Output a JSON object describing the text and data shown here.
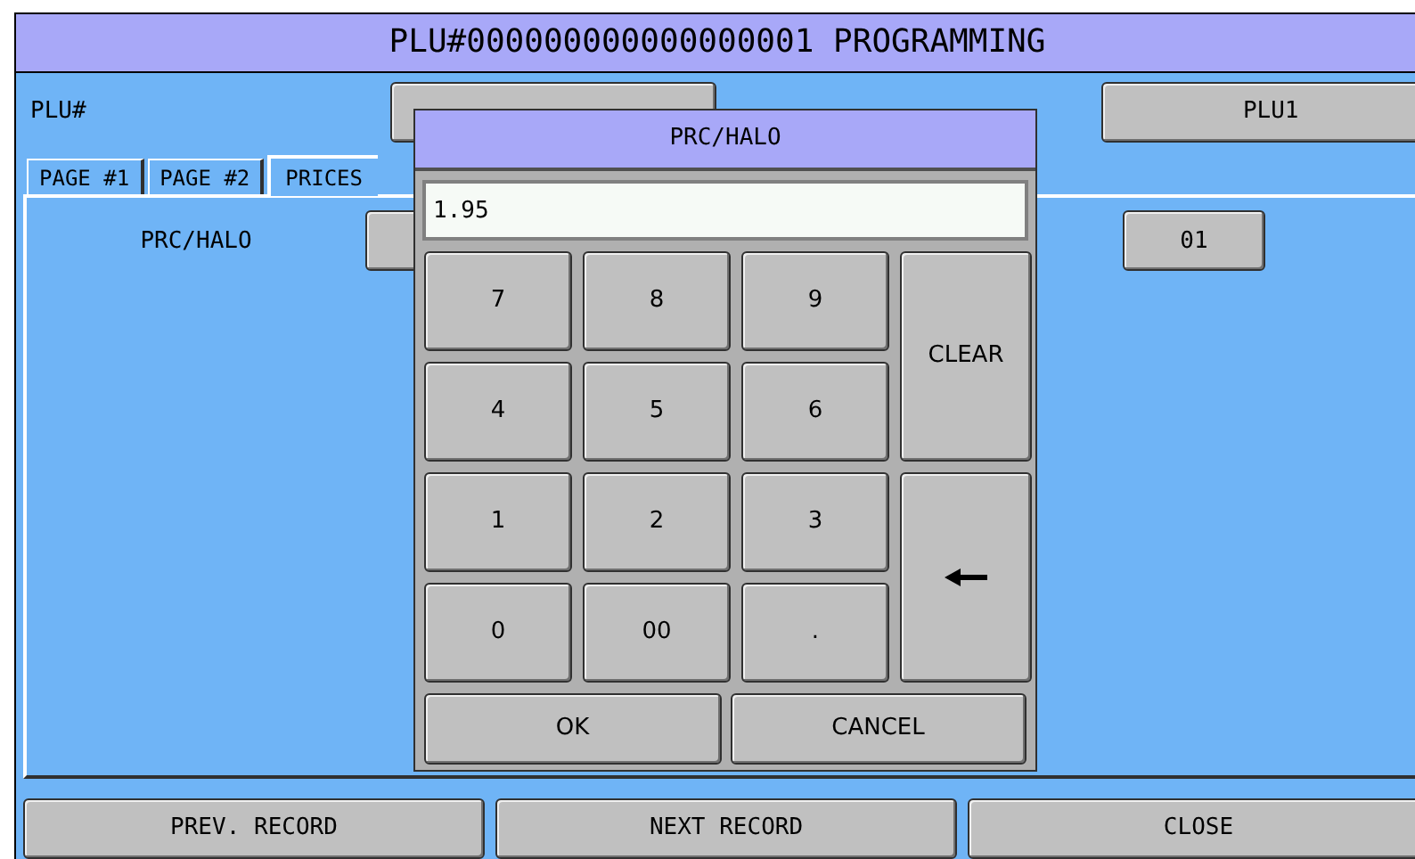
{
  "window": {
    "title": "PLU#000000000000000001 PROGRAMMING"
  },
  "header": {
    "plu_label": "PLU#",
    "descriptor_value": "PLU1"
  },
  "tabs": [
    {
      "label": "PAGE #1",
      "selected": false
    },
    {
      "label": "PAGE #2",
      "selected": false
    },
    {
      "label": "PRICES",
      "selected": true
    }
  ],
  "prices": {
    "label": "PRC/HALO",
    "field_2": "01"
  },
  "dialog": {
    "title": "PRC/HALO",
    "value": "1.95",
    "keys": [
      {
        "kind": "digit",
        "label": "7"
      },
      {
        "kind": "digit",
        "label": "8"
      },
      {
        "kind": "digit",
        "label": "9"
      },
      {
        "kind": "tall",
        "label": "CLEAR"
      },
      {
        "kind": "digit",
        "label": "4"
      },
      {
        "kind": "digit",
        "label": "5"
      },
      {
        "kind": "digit",
        "label": "6"
      },
      {
        "kind": "digit",
        "label": "1"
      },
      {
        "kind": "digit",
        "label": "2"
      },
      {
        "kind": "digit",
        "label": "3"
      },
      {
        "kind": "backspace"
      },
      {
        "kind": "digit",
        "label": "0"
      },
      {
        "kind": "digit",
        "label": "00"
      },
      {
        "kind": "digit",
        "label": "."
      }
    ],
    "buttons": [
      "OK",
      "CANCEL"
    ]
  },
  "footer": [
    "PREV. RECORD",
    "NEXT RECORD",
    "CLOSE"
  ]
}
